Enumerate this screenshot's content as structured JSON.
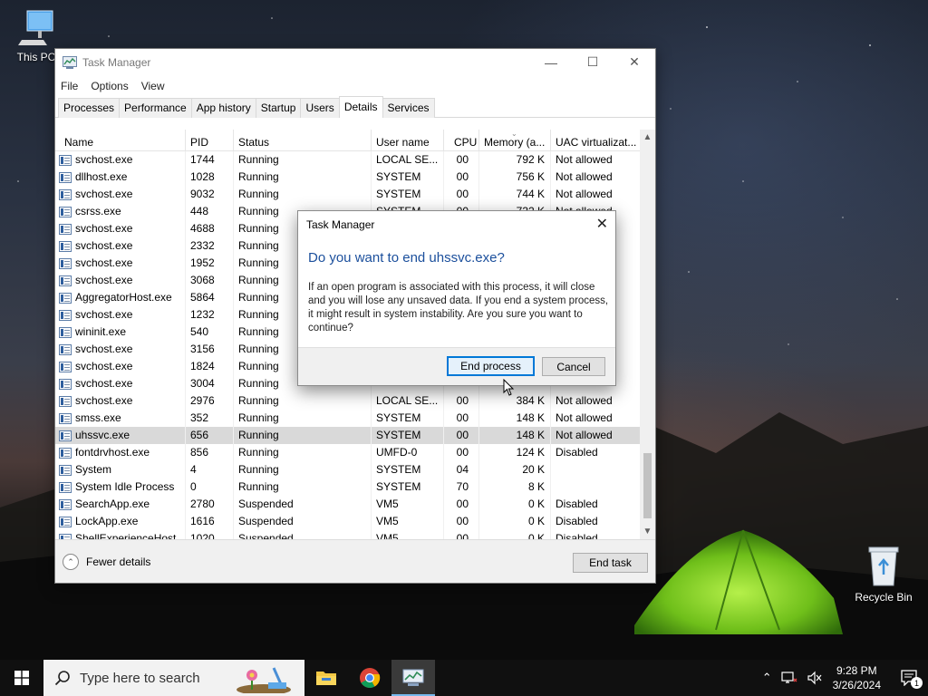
{
  "desktop": {
    "icons": [
      {
        "label": "This PC",
        "icon": "this-pc-icon"
      },
      {
        "label": "Recycle Bin",
        "icon": "recycle-bin-icon"
      }
    ]
  },
  "task_manager": {
    "title": "Task Manager",
    "window_controls": {
      "minimize": "—",
      "maximize": "☐",
      "close": "✕"
    },
    "menu": [
      "File",
      "Options",
      "View"
    ],
    "tabs": [
      "Processes",
      "Performance",
      "App history",
      "Startup",
      "Users",
      "Details",
      "Services"
    ],
    "active_tab": "Details",
    "columns": [
      "Name",
      "PID",
      "Status",
      "User name",
      "CPU",
      "Memory (a...",
      "UAC virtualizat..."
    ],
    "sort_indicator": "⌄",
    "rows": [
      {
        "name": "svchost.exe",
        "pid": "1744",
        "status": "Running",
        "user": "LOCAL SE...",
        "cpu": "00",
        "mem": "792 K",
        "uac": "Not allowed"
      },
      {
        "name": "dllhost.exe",
        "pid": "1028",
        "status": "Running",
        "user": "SYSTEM",
        "cpu": "00",
        "mem": "756 K",
        "uac": "Not allowed"
      },
      {
        "name": "svchost.exe",
        "pid": "9032",
        "status": "Running",
        "user": "SYSTEM",
        "cpu": "00",
        "mem": "744 K",
        "uac": "Not allowed"
      },
      {
        "name": "csrss.exe",
        "pid": "448",
        "status": "Running",
        "user": "SYSTEM",
        "cpu": "00",
        "mem": "732 K",
        "uac": "Not allowed"
      },
      {
        "name": "svchost.exe",
        "pid": "4688",
        "status": "Running",
        "user": "",
        "cpu": "",
        "mem": "",
        "uac": ""
      },
      {
        "name": "svchost.exe",
        "pid": "2332",
        "status": "Running",
        "user": "",
        "cpu": "",
        "mem": "",
        "uac": ""
      },
      {
        "name": "svchost.exe",
        "pid": "1952",
        "status": "Running",
        "user": "",
        "cpu": "",
        "mem": "",
        "uac": ""
      },
      {
        "name": "svchost.exe",
        "pid": "3068",
        "status": "Running",
        "user": "",
        "cpu": "",
        "mem": "",
        "uac": ""
      },
      {
        "name": "AggregatorHost.exe",
        "pid": "5864",
        "status": "Running",
        "user": "",
        "cpu": "",
        "mem": "",
        "uac": ""
      },
      {
        "name": "svchost.exe",
        "pid": "1232",
        "status": "Running",
        "user": "",
        "cpu": "",
        "mem": "",
        "uac": ""
      },
      {
        "name": "wininit.exe",
        "pid": "540",
        "status": "Running",
        "user": "",
        "cpu": "",
        "mem": "",
        "uac": ""
      },
      {
        "name": "svchost.exe",
        "pid": "3156",
        "status": "Running",
        "user": "",
        "cpu": "",
        "mem": "",
        "uac": ""
      },
      {
        "name": "svchost.exe",
        "pid": "1824",
        "status": "Running",
        "user": "",
        "cpu": "",
        "mem": "",
        "uac": ""
      },
      {
        "name": "svchost.exe",
        "pid": "3004",
        "status": "Running",
        "user": "",
        "cpu": "",
        "mem": "",
        "uac": ""
      },
      {
        "name": "svchost.exe",
        "pid": "2976",
        "status": "Running",
        "user": "LOCAL SE...",
        "cpu": "00",
        "mem": "384 K",
        "uac": "Not allowed"
      },
      {
        "name": "smss.exe",
        "pid": "352",
        "status": "Running",
        "user": "SYSTEM",
        "cpu": "00",
        "mem": "148 K",
        "uac": "Not allowed"
      },
      {
        "name": "uhssvc.exe",
        "pid": "656",
        "status": "Running",
        "user": "SYSTEM",
        "cpu": "00",
        "mem": "148 K",
        "uac": "Not allowed",
        "selected": true
      },
      {
        "name": "fontdrvhost.exe",
        "pid": "856",
        "status": "Running",
        "user": "UMFD-0",
        "cpu": "00",
        "mem": "124 K",
        "uac": "Disabled"
      },
      {
        "name": "System",
        "pid": "4",
        "status": "Running",
        "user": "SYSTEM",
        "cpu": "04",
        "mem": "20 K",
        "uac": ""
      },
      {
        "name": "System Idle Process",
        "pid": "0",
        "status": "Running",
        "user": "SYSTEM",
        "cpu": "70",
        "mem": "8 K",
        "uac": ""
      },
      {
        "name": "SearchApp.exe",
        "pid": "2780",
        "status": "Suspended",
        "user": "VM5",
        "cpu": "00",
        "mem": "0 K",
        "uac": "Disabled"
      },
      {
        "name": "LockApp.exe",
        "pid": "1616",
        "status": "Suspended",
        "user": "VM5",
        "cpu": "00",
        "mem": "0 K",
        "uac": "Disabled"
      },
      {
        "name": "ShellExperienceHost...",
        "pid": "1020",
        "status": "Suspended",
        "user": "VM5",
        "cpu": "00",
        "mem": "0 K",
        "uac": "Disabled"
      }
    ],
    "footer": {
      "fewer_details": "Fewer details",
      "end_task": "End task"
    }
  },
  "dialog": {
    "title": "Task Manager",
    "close": "✕",
    "question": "Do you want to end uhssvc.exe?",
    "message": "If an open program is associated with this process, it will close and you will lose any unsaved data. If you end a system process, it might result in system instability. Are you sure you want to continue?",
    "confirm_label": "End process",
    "cancel_label": "Cancel"
  },
  "taskbar": {
    "search_placeholder": "Type here to search",
    "pinned": [
      "file-explorer-icon",
      "chrome-icon",
      "task-manager-icon"
    ],
    "clock_time": "9:28 PM",
    "clock_date": "3/26/2024",
    "notification_count": "1",
    "accent": "#0078d7"
  }
}
